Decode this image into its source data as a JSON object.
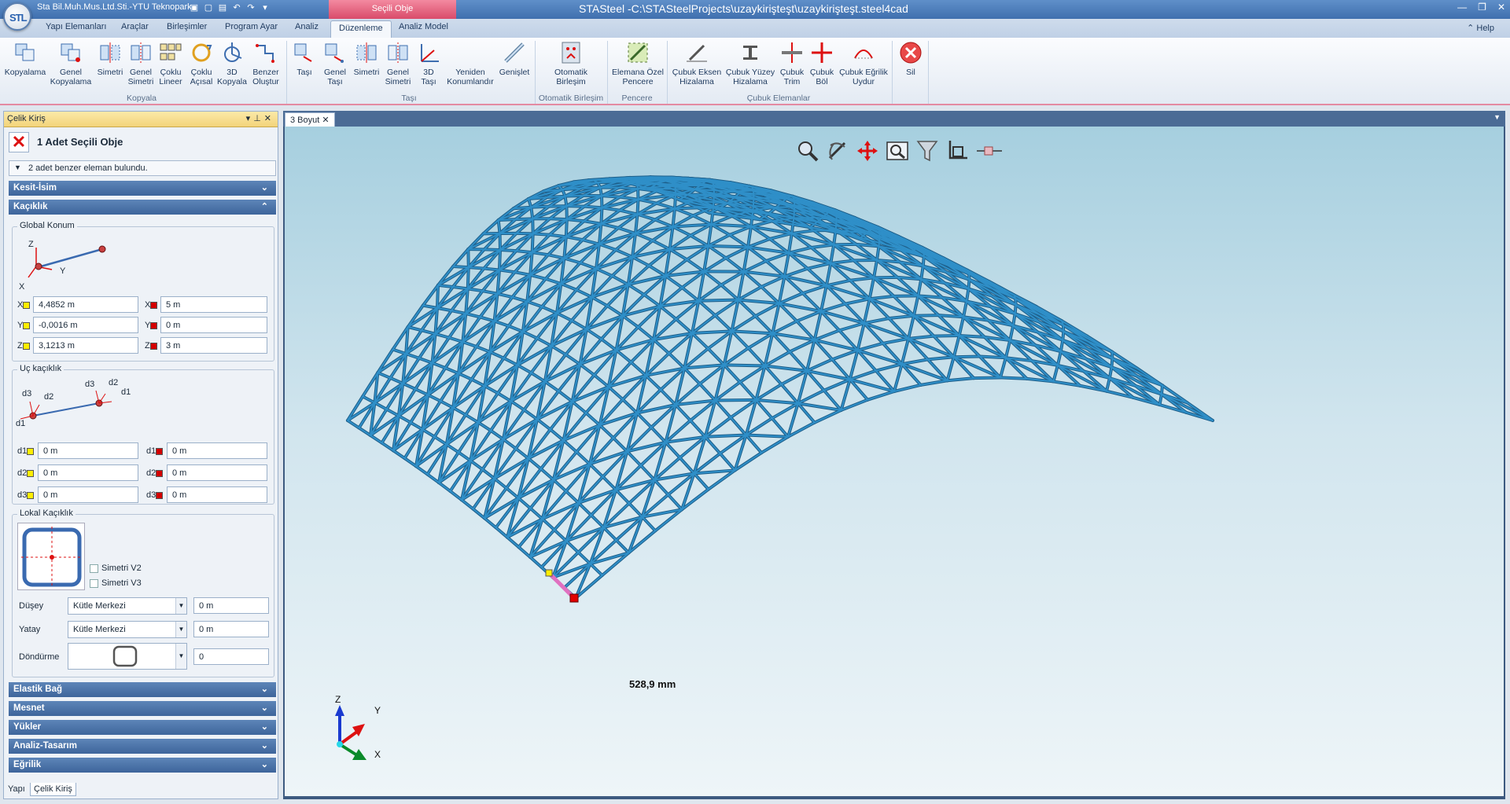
{
  "title_bar": {
    "company": "Sta Bil.Muh.Mus.Ltd.Sti.-YTU Teknopark",
    "app_title": "STASteel -C:\\STASteelProjects\\uzaykirişteşt\\uzaykirişteşt.steel4cad",
    "context_tab": "Seçili Obje"
  },
  "menu_tabs": [
    "Yapı Elemanları",
    "Araçlar",
    "Birleşimler",
    "Program Ayar",
    "Analiz",
    "Düzenleme",
    "Analiz Model"
  ],
  "help_label": "Help",
  "ribbon": {
    "kopyala": {
      "buttons": [
        "Kopyalama",
        "Genel Kopyalama",
        "Simetri",
        "Genel Simetri",
        "Çoklu Lineer",
        "Çoklu Açısal",
        "3D Kopyala",
        "Benzer Oluştur"
      ],
      "label": "Kopyala"
    },
    "tasi": {
      "buttons": [
        "Taşı",
        "Genel Taşı",
        "Simetri",
        "Genel Simetri",
        "3D Taşı",
        "Yeniden Konumlandır",
        "Genişlet"
      ],
      "label": "Taşı"
    },
    "otomatik": {
      "buttons": [
        "Otomatik Birleşim"
      ],
      "label": "Otomatik Birleşim"
    },
    "pencere": {
      "buttons": [
        "Elemana Özel Pencere"
      ],
      "label": "Pencere"
    },
    "cubuk": {
      "buttons": [
        "Çubuk Eksen Hizalama",
        "Çubuk Yüzey Hizalama",
        "Çubuk Trim",
        "Çubuk Böl",
        "Çubuk Eğrilik Uydur"
      ],
      "label": "Çubuk Elemanlar"
    },
    "sil": {
      "buttons": [
        "Sil"
      ]
    }
  },
  "panel": {
    "title": "Çelik Kiriş",
    "selected_title": "1 Adet Seçili Obje",
    "similar_info": "2 adet benzer eleman bulundu.",
    "sections": {
      "kesit": "Kesit-İsim",
      "kaciklik": "Kaçıklık",
      "elastik": "Elastik Bağ",
      "mesnet": "Mesnet",
      "yukler": "Yükler",
      "analiz": "Analiz-Tasarım",
      "egrilik": "Eğrilik"
    },
    "global_konum": {
      "legend": "Global Konum",
      "axes": {
        "z": "Z",
        "y": "Y",
        "x": "X"
      },
      "labels": {
        "x": "X",
        "y": "Y",
        "z": "Z"
      },
      "start": {
        "x": "4,4852 m",
        "y": "-0,0016 m",
        "z": "3,1213 m"
      },
      "end": {
        "x": "5 m",
        "y": "0 m",
        "z": "3 m"
      }
    },
    "uc_kaciklik": {
      "legend": "Uç kaçıklık",
      "labels": {
        "d1": "d1",
        "d2": "d2",
        "d3": "d3"
      },
      "start": {
        "d1": "0 m",
        "d2": "0 m",
        "d3": "0 m"
      },
      "end": {
        "d1": "0 m",
        "d2": "0 m",
        "d3": "0 m"
      }
    },
    "lokal_kaciklik": {
      "legend": "Lokal Kaçıklık",
      "simetri_v2": "Simetri V2",
      "simetri_v3": "Simetri V3",
      "dusey_label": "Düşey",
      "dusey_combo": "Kütle Merkezi",
      "dusey_value": "0 m",
      "yatay_label": "Yatay",
      "yatay_combo": "Kütle Merkezi",
      "yatay_value": "0 m",
      "dondurme_label": "Döndürme",
      "dondurme_value": "0"
    }
  },
  "bottom_tabs": [
    "Yapı",
    "Çelik Kiriş"
  ],
  "document": {
    "tab": "3 Boyut",
    "dimension": "528,9  mm",
    "axes": {
      "z": "Z",
      "y": "Y",
      "x": "X"
    }
  },
  "colors": {
    "structure": "#2f8fc8",
    "highlight": "#e070c0",
    "accent": "#e48aa2"
  }
}
